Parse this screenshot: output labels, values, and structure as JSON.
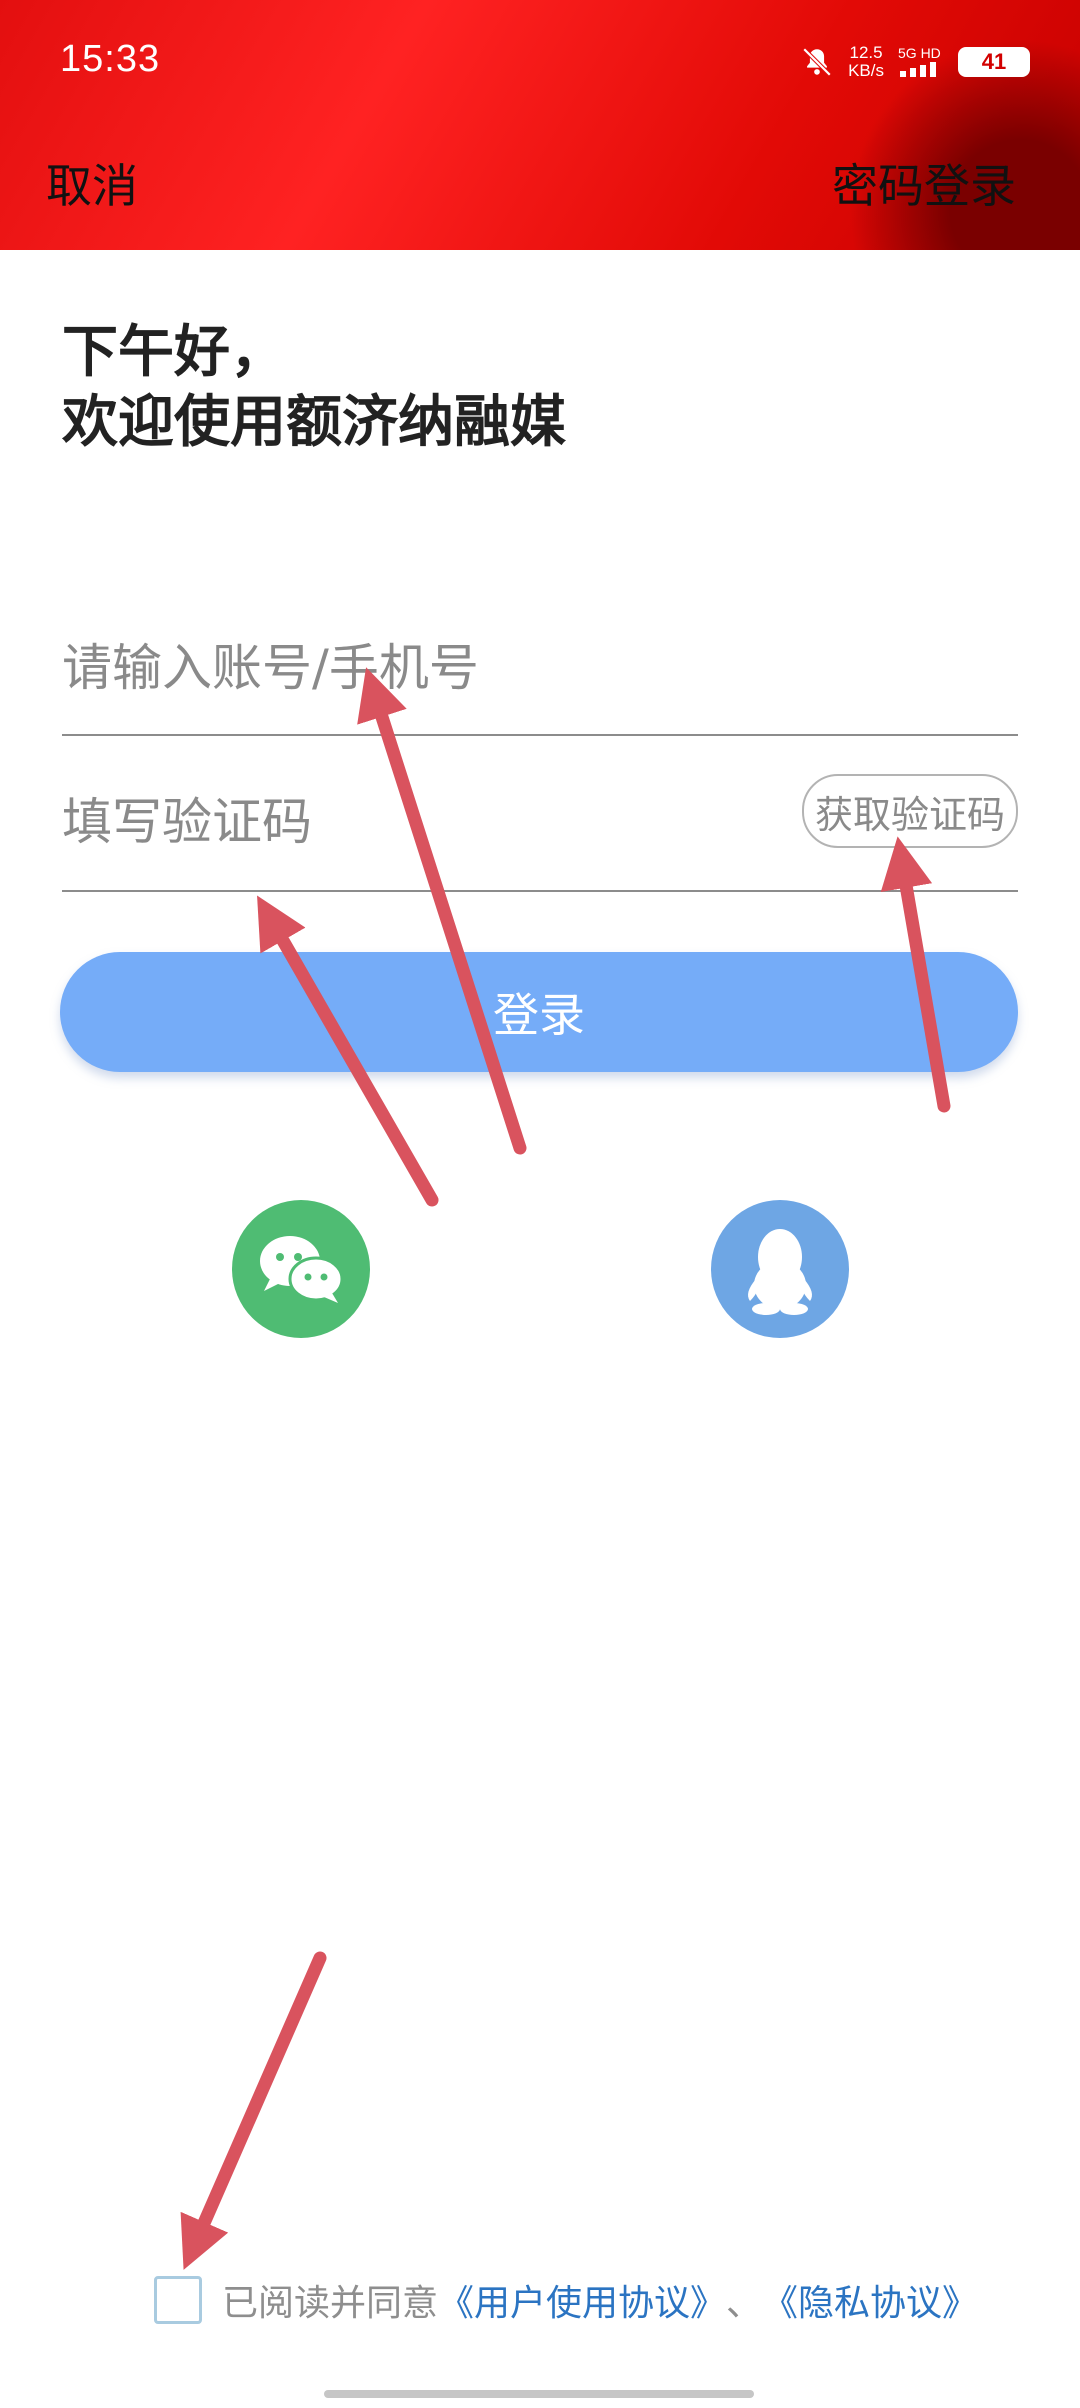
{
  "status_bar": {
    "time": "15:33",
    "net_speed_value": "12.5",
    "net_speed_unit": "KB/s",
    "net_type": "5G HD",
    "battery": "41"
  },
  "header": {
    "cancel_label": "取消",
    "password_login_label": "密码登录"
  },
  "greeting": {
    "line1": "下午好，",
    "line2": "欢迎使用额济纳融媒"
  },
  "form": {
    "account_placeholder": "请输入账号/手机号",
    "code_placeholder": "填写验证码",
    "get_code_label": "获取验证码",
    "login_label": "登录"
  },
  "social": {
    "wechat_icon": "wechat-icon",
    "qq_icon": "qq-icon"
  },
  "agreement": {
    "prefix": "已阅读并同意",
    "user_agreement": "《用户使用协议》",
    "separator": "、",
    "privacy_agreement": "《隐私协议》"
  },
  "colors": {
    "header_red": "#e30f0f",
    "login_button": "#75acf8",
    "wechat_green": "#4fbc73",
    "qq_blue": "#6ea6e4",
    "link_blue": "#2b74c2",
    "annotation_arrow": "#d9535e"
  }
}
